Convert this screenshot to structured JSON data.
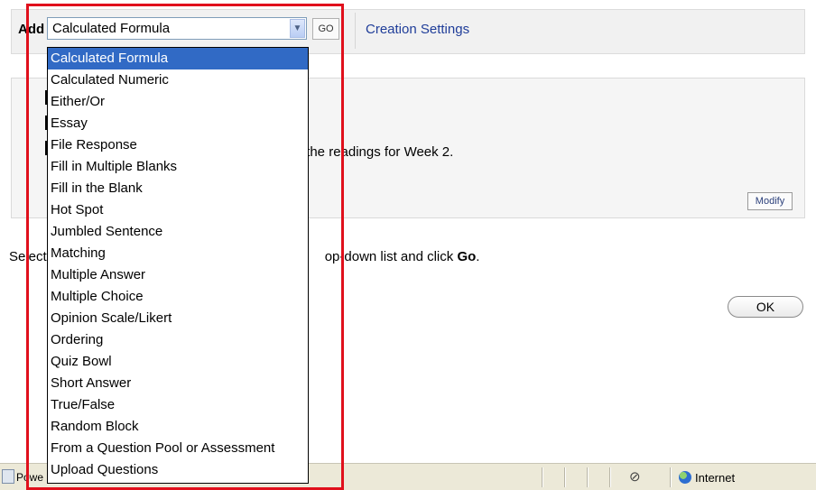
{
  "toolbar": {
    "add_label": "Add",
    "selected_question_type": "Calculated Formula",
    "go_label": "GO",
    "creation_settings_label": "Creation Settings"
  },
  "question": {
    "text_fragment": "all the readings for Week 2.",
    "modify_label": "Modify"
  },
  "instructions": {
    "before": "Select",
    "middle": "op-down list and click ",
    "bold": "Go",
    "after": "."
  },
  "ok_label": "OK",
  "status_bar": {
    "text": "Powe",
    "zone": "Internet"
  },
  "dropdown": {
    "options": [
      "Calculated Formula",
      "Calculated Numeric",
      "Either/Or",
      "Essay",
      "File Response",
      "Fill in Multiple Blanks",
      "Fill in the Blank",
      "Hot Spot",
      "Jumbled Sentence",
      "Matching",
      "Multiple Answer",
      "Multiple Choice",
      "Opinion Scale/Likert",
      "Ordering",
      "Quiz Bowl",
      "Short Answer",
      "True/False",
      "Random Block",
      "From a Question Pool or Assessment",
      "Upload Questions"
    ],
    "selected": "Calculated Formula"
  },
  "colors": {
    "highlight_frame": "#e0101c",
    "selected_option": "#316ac5",
    "link": "#1f3d99"
  },
  "icons": {
    "dropdown_arrow": "chevron-down-icon",
    "blocked": "popup-blocked-icon",
    "zone": "globe-icon",
    "page": "page-icon"
  }
}
